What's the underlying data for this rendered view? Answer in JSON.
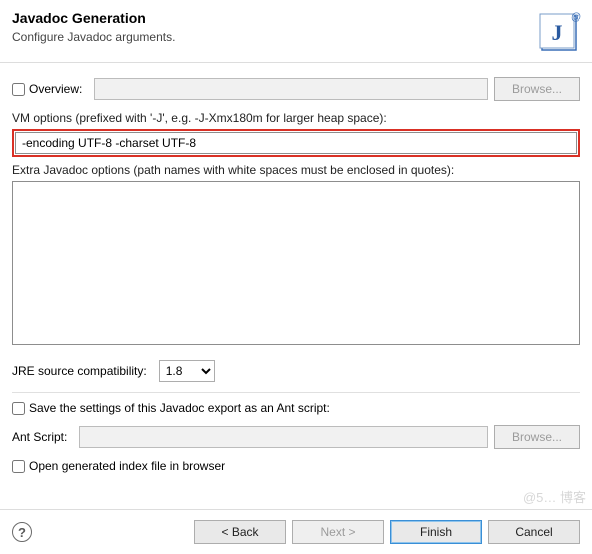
{
  "header": {
    "title": "Javadoc Generation",
    "subtitle": "Configure Javadoc arguments."
  },
  "overview": {
    "checkbox_label": "Overview:",
    "value": "",
    "browse_label": "Browse..."
  },
  "vm": {
    "label": "VM options (prefixed with '-J', e.g. -J-Xmx180m for larger heap space):",
    "value": "-encoding UTF-8 -charset UTF-8"
  },
  "extra": {
    "label": "Extra Javadoc options (path names with white spaces must be enclosed in quotes):",
    "value": ""
  },
  "jre": {
    "label": "JRE source compatibility:",
    "value": "1.8"
  },
  "save_ant": {
    "checkbox_label": "Save the settings of this Javadoc export as an Ant script:"
  },
  "ant_script": {
    "label": "Ant Script:",
    "value": "",
    "browse_label": "Browse..."
  },
  "open_index": {
    "checkbox_label": "Open generated index file in browser"
  },
  "footer": {
    "back": "< Back",
    "next": "Next >",
    "finish": "Finish",
    "cancel": "Cancel"
  },
  "watermark": "@5… 博客"
}
